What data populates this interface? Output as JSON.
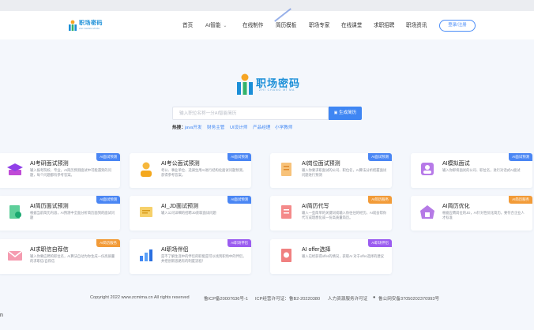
{
  "header": {
    "logo_text": "职场密码",
    "logo_sub": "ZHI CHANG MI MA",
    "nav": [
      {
        "label": "首页"
      },
      {
        "label": "AI智能"
      },
      {
        "label": "在线制作"
      },
      {
        "label": "简历模板"
      },
      {
        "label": "职场专家"
      },
      {
        "label": "在线课堂"
      },
      {
        "label": "求职招聘"
      },
      {
        "label": "职场资讯"
      }
    ],
    "nav_dropdown_icon": "chevron-down-icon",
    "login_label": "登录/注册"
  },
  "hero": {
    "logo_text": "职场密码",
    "logo_sub": "ZHI CHANG MI MA",
    "search_placeholder": "输入职位名称一分AI智能简历",
    "search_button": "生成简历",
    "hot_label": "热搜：",
    "hot_tags": [
      "java开发",
      "财务主管",
      "UI设计师",
      "产品经理",
      "小学教师"
    ]
  },
  "cards": [
    {
      "title": "AI考研面试预测",
      "desc": "输入报考院校、专业，AI简历预测面试中可能遇到的问题，每个问题都有参考答案。",
      "badge": "AI面试预测",
      "badge_color": "#4a86f4",
      "icon": "graduation-cap-icon"
    },
    {
      "title": "AI考公面试预测",
      "desc": "考公、事业单位、选调生用AI进行结构化面试问题预测，获得参考答案。",
      "badge": "AI面试预测",
      "badge_color": "#4a86f4",
      "icon": "person-icon"
    },
    {
      "title": "AI岗位面试预测",
      "desc": "输入你要求职面试的公司、职位名，AI算法分析把握面试问题进行预测",
      "badge": "AI面试预测",
      "badge_color": "#4a86f4",
      "icon": "document-icon"
    },
    {
      "title": "AI模拟面试",
      "desc": "输入你即将面试的公司、职位名，进行对话式AI面试",
      "badge": "AI面试预测",
      "badge_color": "#4a86f4",
      "icon": "user-badge-icon"
    },
    {
      "title": "AI简历面试预测",
      "desc": "根据当前简历内容，AI预测中全面分析简历面到的面试问题",
      "badge": "AI面试预测",
      "badge_color": "#4a86f4",
      "icon": "resume-scan-icon"
    },
    {
      "title": "AI_JD面试预测",
      "desc": "输入公司详细的招聘JD获取面试问题",
      "badge": "AI面试预测",
      "badge_color": "#4a86f4",
      "icon": "jd-document-icon"
    },
    {
      "title": "AI简历代写",
      "desc": "输入一些简单的关键词或输入你往往的经历，AI就会帮你代写成理想化或一份高质量简历。",
      "badge": "AI简历服务",
      "badge_color": "#f29b38",
      "icon": "resume-write-icon"
    },
    {
      "title": "AI简历优化",
      "desc": "根据应聘岗位的JD，AI针对性优化简历，要符合企业人才标准",
      "badge": "AI简历服务",
      "badge_color": "#f29b38",
      "icon": "resume-optimize-icon"
    },
    {
      "title": "AI求职信自荐信",
      "desc": "输入你要应聘的职位名，AI算法自动为你生成一份高质量的求职信/自荐信",
      "badge": "AI简历服务",
      "badge_color": "#f29b38",
      "icon": "letter-icon"
    },
    {
      "title": "AI职场伴侣",
      "desc": "是不了解生涯中的伴侣的职能是可以找到职场中的伴侣，并把创新思路有的制度流程！",
      "badge": "AI职场伴侣",
      "badge_color": "#9b5cf0",
      "icon": "chart-icon"
    },
    {
      "title": "AI offer选择",
      "desc": "输入已经获得offer的情况，获取AI 对于offer选择的建议",
      "badge": "AI职场伴侣",
      "badge_color": "#9b5cf0",
      "icon": "offer-choice-icon"
    }
  ],
  "footer": {
    "copyright": "Copyright 2022 www.zcmima.cn All rights reserved",
    "icp": "鲁ICP备20007636号-1",
    "license": "ICP经营许可证：鲁B2-20220380",
    "hr_license": "人力资源服务许可证",
    "police": "鲁公网安备37050202370993号"
  },
  "bottom_fragment": "n"
}
